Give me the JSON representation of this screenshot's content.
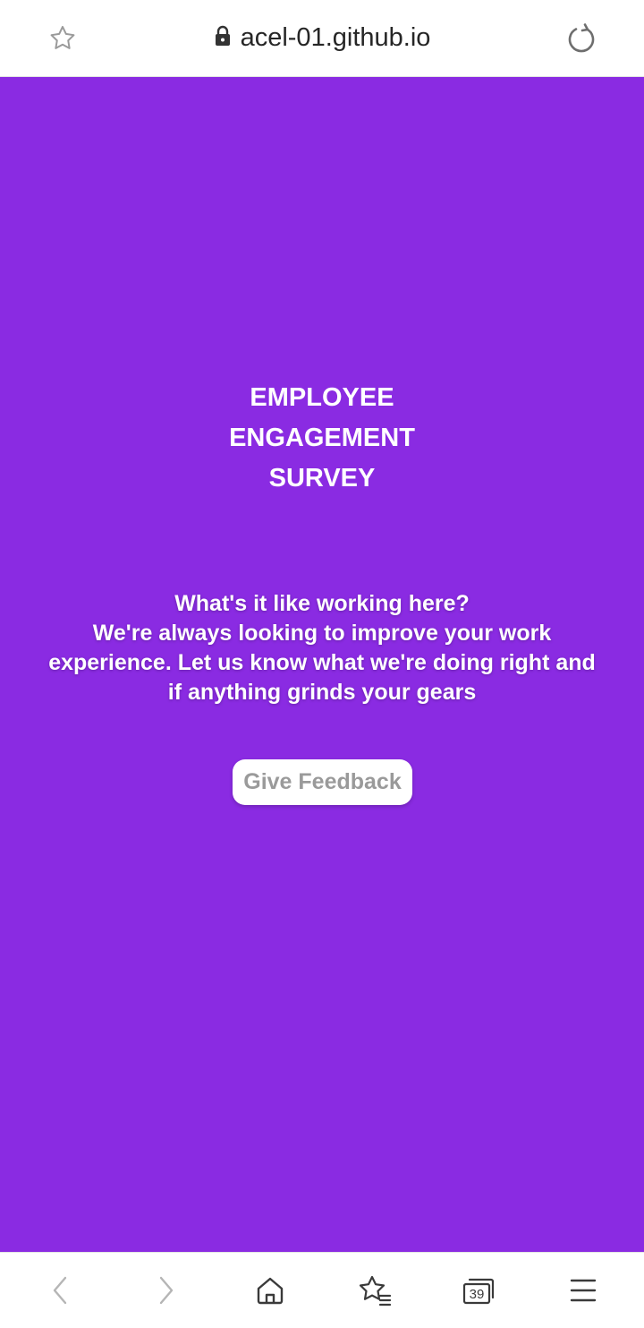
{
  "browser": {
    "url": "acel-01.github.io",
    "tab_count": "39",
    "icons": {
      "bookmark": "star-outline-icon",
      "lock": "lock-icon",
      "reload": "reload-icon",
      "back": "chevron-left-icon",
      "forward": "chevron-right-icon",
      "home": "home-icon",
      "bookmarks": "star-list-icon",
      "tabs": "tabs-icon",
      "menu": "hamburger-menu-icon"
    }
  },
  "page": {
    "background_color": "#8a2be2",
    "title_lines": [
      "EMPLOYEE",
      "ENGAGEMENT",
      "SURVEY"
    ],
    "question": "What's it like working here?",
    "description": "We're always looking to improve your work experience. Let us know what we're doing right and if anything grinds your gears",
    "cta_label": "Give Feedback"
  }
}
